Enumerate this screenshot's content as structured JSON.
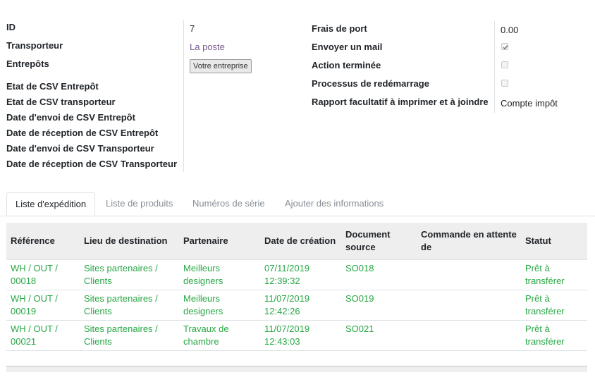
{
  "form": {
    "left_labels": [
      "ID",
      "Transporteur",
      "Entrepôts",
      "Etat de CSV Entrepôt",
      "Etat de CSV transporteur",
      "Date d'envoi de CSV Entrepôt",
      "Date de réception de CSV Entrepôt",
      "Date d'envoi de CSV Transporteur",
      "Date de réception de CSV Transporteur"
    ],
    "id_value": "7",
    "transporteur_value": "La poste",
    "entrepots_button": "Votre entreprise",
    "right_labels": [
      "Frais de port",
      "Envoyer un mail",
      "Action terminée",
      "Processus de redémarrage",
      "Rapport facultatif à imprimer et à joindre"
    ],
    "frais_value": "0.00",
    "envoyer_mail_checked": true,
    "action_terminee_checked": false,
    "processus_checked": false,
    "rapport_value": "Compte impôt"
  },
  "tabs": [
    {
      "label": "Liste d'expédition",
      "active": true
    },
    {
      "label": "Liste de produits",
      "active": false
    },
    {
      "label": "Numéros de série",
      "active": false
    },
    {
      "label": "Ajouter des informations",
      "active": false
    }
  ],
  "table": {
    "headers": [
      "Référence",
      "Lieu de destination",
      "Partenaire",
      "Date de création",
      "Document source",
      "Commande en attente de",
      "Statut"
    ],
    "rows": [
      [
        "WH / OUT / 00018",
        "Sites partenaires / Clients",
        "Meilleurs designers",
        "07/11/2019 12:39:32",
        "SO018",
        "",
        "Prêt à transférer"
      ],
      [
        "WH / OUT / 00019",
        "Sites partenaires / Clients",
        "Meilleurs designers",
        "11/07/2019 12:42:26",
        "SO019",
        "",
        "Prêt à transférer"
      ],
      [
        "WH / OUT / 00021",
        "Sites partenaires / Clients",
        "Travaux de chambre",
        "11/07/2019 12:43:03",
        "SO021",
        "",
        "Prêt à transférer"
      ]
    ]
  },
  "colors": {
    "link": "#7c5a8f",
    "row_text": "#28a745",
    "header_bg": "#eeeeee"
  }
}
